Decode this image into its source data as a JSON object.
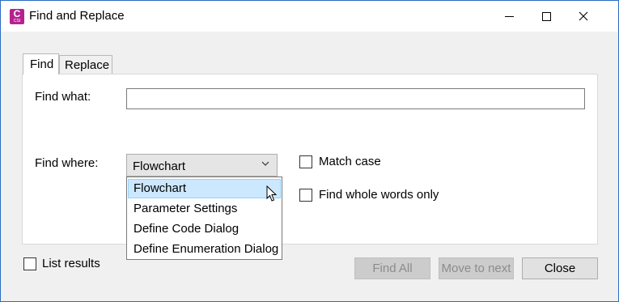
{
  "window": {
    "title": "Find and Replace",
    "app_icon_letter": "C",
    "app_icon_sub": "CSI",
    "app_icon_color": "#b5228f"
  },
  "tabs": [
    {
      "label": "Find",
      "active": true
    },
    {
      "label": "Replace",
      "active": false
    }
  ],
  "find_what": {
    "label": "Find what:",
    "value": ""
  },
  "find_where": {
    "label": "Find where:",
    "selected": "Flowchart",
    "options": [
      "Flowchart",
      "Parameter Settings",
      "Define Code Dialog",
      "Define Enumeration Dialog"
    ],
    "highlighted_option": "Flowchart"
  },
  "options": {
    "match_case": {
      "label": "Match case",
      "checked": false
    },
    "whole_words": {
      "label": "Find whole words only",
      "checked": false
    },
    "list_results": {
      "label": "List results",
      "checked": false
    }
  },
  "buttons": {
    "find_all": {
      "label": "Find All",
      "enabled": false
    },
    "move_next": {
      "label": "Move to next",
      "enabled": false
    },
    "close": {
      "label": "Close",
      "enabled": true
    }
  },
  "colors": {
    "selection_bg": "#cce8ff",
    "window_border": "#2b6cc4"
  }
}
